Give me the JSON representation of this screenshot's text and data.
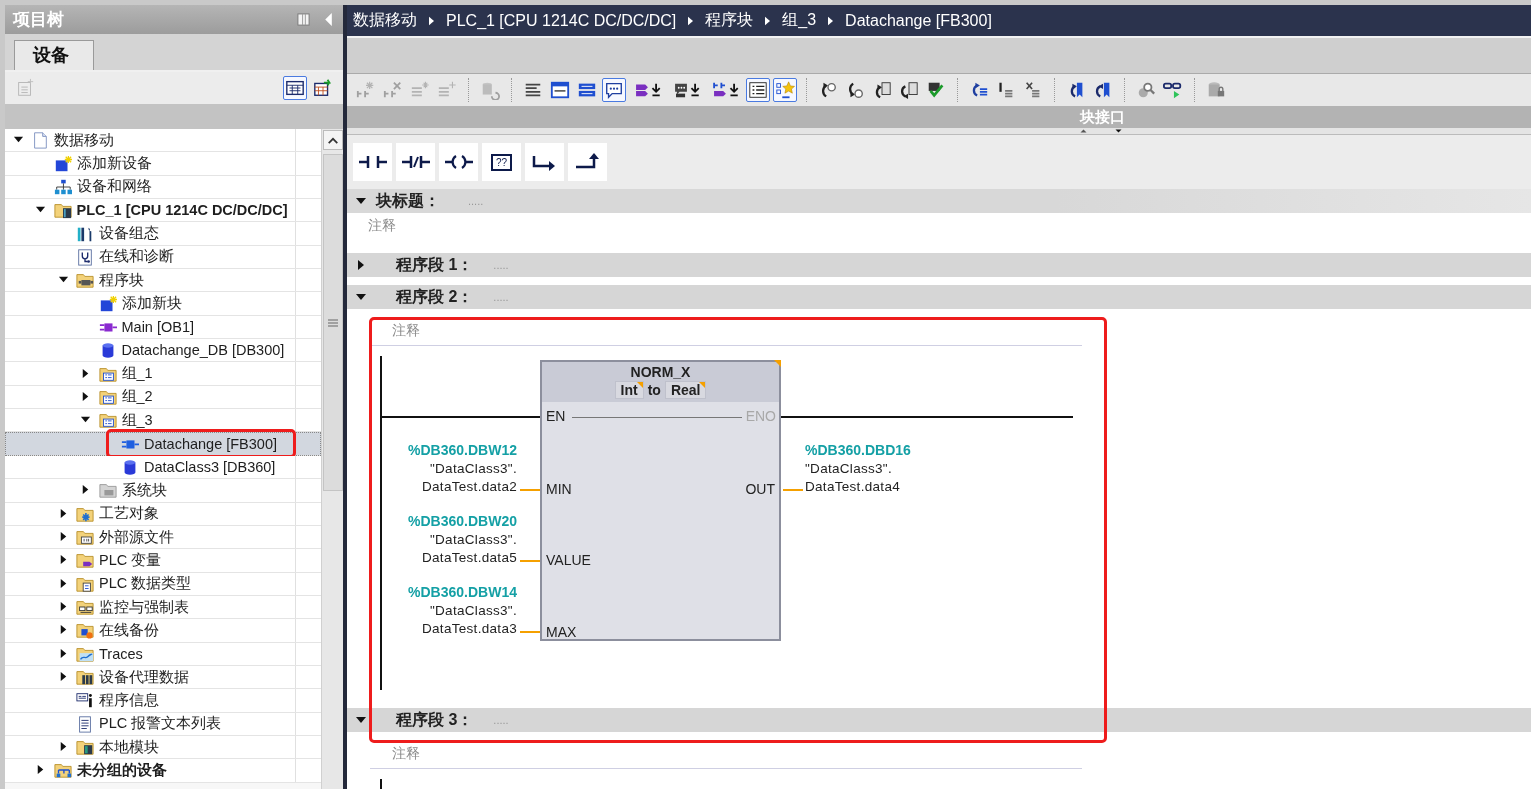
{
  "project_tree": {
    "title": "项目树",
    "tabs": [
      {
        "label": "设备",
        "selected": true
      }
    ],
    "toolbar": [
      {
        "kind": "new-view",
        "on": false,
        "disabled": true
      },
      {
        "kind": "overview",
        "on": true,
        "disabled": false
      },
      {
        "kind": "overview-export",
        "on": false,
        "disabled": false
      }
    ],
    "items": [
      {
        "label": "数据移动",
        "kind": "project",
        "expanded": true,
        "selected": false,
        "highlighted": false,
        "children": [
          {
            "label": "添加新设备",
            "kind": "add",
            "selected": false,
            "highlighted": false
          },
          {
            "label": "设备和网络",
            "kind": "network",
            "selected": false,
            "highlighted": false
          },
          {
            "label": "PLC_1 [CPU 1214C DC/DC/DC]",
            "kind": "plc",
            "expanded": true,
            "selected": false,
            "highlighted": false,
            "children": [
              {
                "label": "设备组态",
                "kind": "config",
                "selected": false,
                "highlighted": false
              },
              {
                "label": "在线和诊断",
                "kind": "diag",
                "selected": false,
                "highlighted": false
              },
              {
                "label": "程序块",
                "kind": "program",
                "expanded": true,
                "selected": false,
                "highlighted": false,
                "children": [
                  {
                    "label": "添加新块",
                    "kind": "add",
                    "selected": false,
                    "highlighted": false
                  },
                  {
                    "label": "Main [OB1]",
                    "kind": "ob",
                    "selected": false,
                    "highlighted": false
                  },
                  {
                    "label": "Datachange_DB [DB300]",
                    "kind": "db",
                    "selected": false,
                    "highlighted": false
                  },
                  {
                    "label": "组_1",
                    "kind": "group",
                    "expanded": false,
                    "selected": false,
                    "highlighted": false
                  },
                  {
                    "label": "组_2",
                    "kind": "group",
                    "expanded": false,
                    "selected": false,
                    "highlighted": false
                  },
                  {
                    "label": "组_3",
                    "kind": "group",
                    "expanded": true,
                    "selected": false,
                    "highlighted": false,
                    "children": [
                      {
                        "label": "Datachange [FB300]",
                        "kind": "fb",
                        "selected": true,
                        "highlighted": true
                      },
                      {
                        "label": "DataClass3 [DB360]",
                        "kind": "db",
                        "selected": false,
                        "highlighted": false
                      }
                    ]
                  },
                  {
                    "label": "系统块",
                    "kind": "system",
                    "expanded": false,
                    "selected": false,
                    "highlighted": false
                  }
                ]
              },
              {
                "label": "工艺对象",
                "kind": "tech",
                "expanded": false,
                "selected": false,
                "highlighted": false
              },
              {
                "label": "外部源文件",
                "kind": "source",
                "expanded": false,
                "selected": false,
                "highlighted": false
              },
              {
                "label": "PLC 变量",
                "kind": "tags",
                "expanded": false,
                "selected": false,
                "highlighted": false
              },
              {
                "label": "PLC 数据类型",
                "kind": "types",
                "expanded": false,
                "selected": false,
                "highlighted": false
              },
              {
                "label": "监控与强制表",
                "kind": "watch",
                "expanded": false,
                "selected": false,
                "highlighted": false
              },
              {
                "label": "在线备份",
                "kind": "backup",
                "expanded": false,
                "selected": false,
                "highlighted": false
              },
              {
                "label": "Traces",
                "kind": "traces",
                "expanded": false,
                "selected": false,
                "highlighted": false
              },
              {
                "label": "设备代理数据",
                "kind": "proxy",
                "expanded": false,
                "selected": false,
                "highlighted": false
              },
              {
                "label": "程序信息",
                "kind": "info",
                "selected": false,
                "highlighted": false
              },
              {
                "label": "PLC 报警文本列表",
                "kind": "alarm",
                "selected": false,
                "highlighted": false
              },
              {
                "label": "本地模块",
                "kind": "local",
                "expanded": false,
                "selected": false,
                "highlighted": false
              }
            ]
          },
          {
            "label": "未分组的设备",
            "kind": "ungrouped",
            "expanded": false,
            "selected": false,
            "highlighted": false
          }
        ]
      }
    ]
  },
  "editor": {
    "breadcrumb": [
      "数据移动",
      "PLC_1 [CPU 1214C DC/DC/DC]",
      "程序块",
      "组_3",
      "Datachange [FB300]"
    ],
    "toolbar": [
      {
        "kind": "insert-network",
        "on": false,
        "disabled": true
      },
      {
        "kind": "delete-network",
        "on": false,
        "disabled": true
      },
      {
        "kind": "insert-row",
        "on": false,
        "disabled": true
      },
      {
        "kind": "delete-row",
        "on": false,
        "disabled": true
      },
      {
        "kind": "separator"
      },
      {
        "kind": "db-undo",
        "on": false,
        "disabled": true
      },
      {
        "kind": "separator"
      },
      {
        "kind": "lines",
        "on": false,
        "disabled": false
      },
      {
        "kind": "panel-top",
        "on": false,
        "disabled": false
      },
      {
        "kind": "panel-bars",
        "on": false,
        "disabled": false
      },
      {
        "kind": "comment",
        "on": true,
        "disabled": false
      },
      {
        "kind": "tag-download",
        "on": false,
        "disabled": false
      },
      {
        "kind": "comment-download",
        "on": false,
        "disabled": false
      },
      {
        "kind": "network-download",
        "on": false,
        "disabled": false
      },
      {
        "kind": "list",
        "on": true,
        "disabled": false
      },
      {
        "kind": "favorites",
        "on": true,
        "disabled": false
      },
      {
        "kind": "separator"
      },
      {
        "kind": "call-arrow",
        "on": false,
        "disabled": false
      },
      {
        "kind": "return-arrow",
        "on": false,
        "disabled": false
      },
      {
        "kind": "block-arrow",
        "on": false,
        "disabled": false
      },
      {
        "kind": "block-arrow-back",
        "on": false,
        "disabled": false
      },
      {
        "kind": "compile",
        "on": false,
        "disabled": false
      },
      {
        "kind": "separator"
      },
      {
        "kind": "arrow-list",
        "on": false,
        "disabled": false
      },
      {
        "kind": "bar-list",
        "on": false,
        "disabled": false
      },
      {
        "kind": "cross-list",
        "on": false,
        "disabled": false
      },
      {
        "kind": "separator"
      },
      {
        "kind": "bookmark-prev",
        "on": false,
        "disabled": false
      },
      {
        "kind": "bookmark-next",
        "on": false,
        "disabled": false
      },
      {
        "kind": "separator"
      },
      {
        "kind": "magnifier",
        "on": false,
        "disabled": false
      },
      {
        "kind": "glasses",
        "on": false,
        "disabled": false
      },
      {
        "kind": "separator"
      },
      {
        "kind": "db-lock",
        "on": false,
        "disabled": false
      }
    ],
    "block_interface": "块接口",
    "instructions": [
      {
        "kind": "no-contact"
      },
      {
        "kind": "nc-contact"
      },
      {
        "kind": "coil"
      },
      {
        "kind": "empty-box",
        "label": "??"
      },
      {
        "kind": "branch-open"
      },
      {
        "kind": "branch-close"
      }
    ],
    "block_title": {
      "label": "块标题：",
      "title": ".....",
      "expanded": true,
      "comment": "注释"
    },
    "networks": [
      {
        "label": "程序段 1：",
        "title": ".....",
        "expanded": false,
        "highlighted": false
      },
      {
        "label": "程序段 2：",
        "title": ".....",
        "expanded": true,
        "highlighted": true,
        "comment": "注释",
        "ladder": {
          "box": {
            "name": "NORM_X",
            "type_in": "Int",
            "to": "to",
            "type_out": "Real",
            "en": "EN",
            "eno": "ENO"
          },
          "inputs": [
            {
              "pin": "MIN",
              "address": "%DB360.DBW12",
              "symbol": [
                "\"DataClass3\".",
                "DataTest.data2"
              ]
            },
            {
              "pin": "VALUE",
              "address": "%DB360.DBW20",
              "symbol": [
                "\"DataClass3\".",
                "DataTest.data5"
              ]
            },
            {
              "pin": "MAX",
              "address": "%DB360.DBW14",
              "symbol": [
                "\"DataClass3\".",
                "DataTest.data3"
              ]
            }
          ],
          "outputs": [
            {
              "pin": "OUT",
              "address": "%DB360.DBD16",
              "symbol": [
                "\"DataClass3\".",
                "DataTest.data4"
              ]
            }
          ]
        }
      },
      {
        "label": "程序段 3：",
        "title": ".....",
        "expanded": true,
        "highlighted": false,
        "comment": "注释",
        "rail": true
      }
    ]
  }
}
